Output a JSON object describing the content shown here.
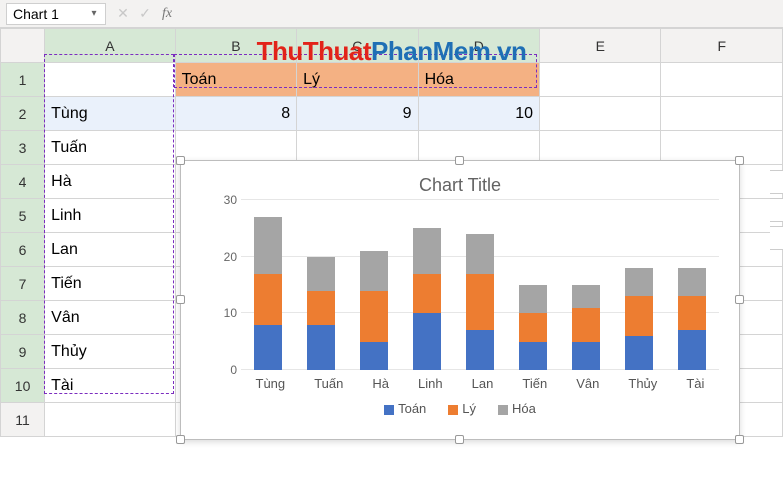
{
  "namebox": {
    "value": "Chart 1"
  },
  "formula_bar": {
    "cancel": "✕",
    "confirm": "✓",
    "fx": "fx",
    "value": ""
  },
  "columns": [
    "A",
    "B",
    "C",
    "D",
    "E",
    "F"
  ],
  "rows": [
    "1",
    "2",
    "3",
    "4",
    "5",
    "6",
    "7",
    "8",
    "9",
    "10",
    "11"
  ],
  "headers": {
    "b": "Toán",
    "c": "Lý",
    "d": "Hóa"
  },
  "names": [
    "Tùng",
    "Tuấn",
    "Hà",
    "Linh",
    "Lan",
    "Tiến",
    "Vân",
    "Thủy",
    "Tài"
  ],
  "row2": {
    "b": "8",
    "c": "9",
    "d": "10"
  },
  "watermark": {
    "a": "ThuThuat",
    "b": "PhanMem",
    "c": ".vn"
  },
  "chart_data": {
    "type": "bar",
    "stacked": true,
    "title": "Chart Title",
    "categories": [
      "Tùng",
      "Tuấn",
      "Hà",
      "Linh",
      "Lan",
      "Tiến",
      "Vân",
      "Thủy",
      "Tài"
    ],
    "series": [
      {
        "name": "Toán",
        "color": "#4472c4",
        "values": [
          8,
          8,
          5,
          10,
          7,
          5,
          5,
          6,
          7
        ]
      },
      {
        "name": "Lý",
        "color": "#ed7d31",
        "values": [
          9,
          6,
          9,
          7,
          10,
          5,
          6,
          7,
          6
        ]
      },
      {
        "name": "Hóa",
        "color": "#a5a5a5",
        "values": [
          10,
          6,
          7,
          8,
          7,
          5,
          4,
          5,
          5
        ]
      }
    ],
    "ylim": [
      0,
      30
    ],
    "yticks": [
      0,
      10,
      20,
      30
    ],
    "legend_position": "bottom"
  }
}
